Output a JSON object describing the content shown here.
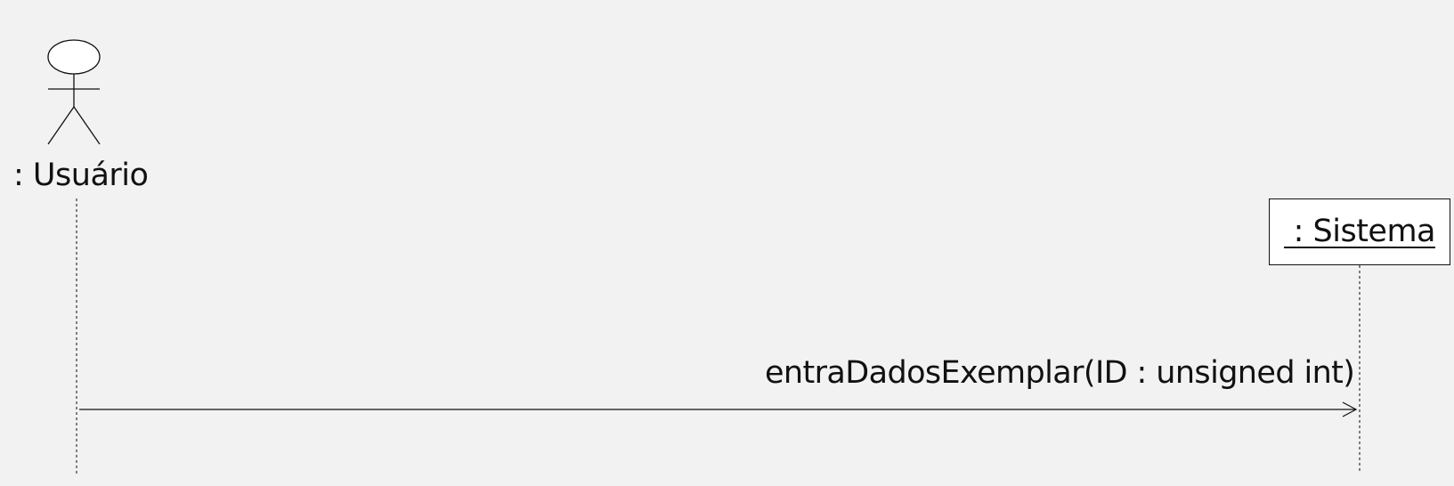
{
  "diagram": {
    "type": "uml-sequence",
    "actor": {
      "label": ": Usuário"
    },
    "object": {
      "label": " : Sistema"
    },
    "message": {
      "label": "entraDadosExemplar(ID : unsigned int)"
    },
    "colors": {
      "background": "#f2f2f2",
      "stroke": "#111111",
      "object_fill": "#ffffff"
    }
  }
}
